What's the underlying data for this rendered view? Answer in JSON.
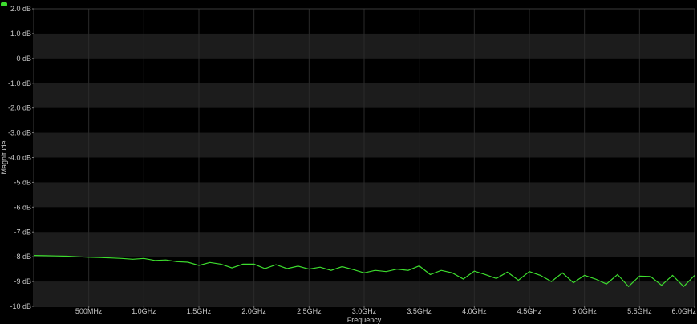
{
  "chart_data": {
    "type": "line",
    "title": "",
    "xlabel": "Frequency",
    "ylabel": "Magnitude",
    "xlim": [
      0,
      6.0
    ],
    "ylim": [
      -10,
      2
    ],
    "x_unit": "GHz",
    "y_unit": "dB",
    "x_ticks": [
      {
        "value": 0.5,
        "label": "500MHz"
      },
      {
        "value": 1.0,
        "label": "1.0GHz"
      },
      {
        "value": 1.5,
        "label": "1.5GHz"
      },
      {
        "value": 2.0,
        "label": "2.0GHz"
      },
      {
        "value": 2.5,
        "label": "2.5GHz"
      },
      {
        "value": 3.0,
        "label": "3.0GHz"
      },
      {
        "value": 3.5,
        "label": "3.5GHz"
      },
      {
        "value": 4.0,
        "label": "4.0GHz"
      },
      {
        "value": 4.5,
        "label": "4.5GHz"
      },
      {
        "value": 5.0,
        "label": "5.0GHz"
      },
      {
        "value": 5.5,
        "label": "5.5GHz"
      },
      {
        "value": 6.0,
        "label": "6.0GHz"
      }
    ],
    "y_ticks": [
      {
        "value": 2,
        "label": "2.0 dB"
      },
      {
        "value": 1,
        "label": "1.0 dB"
      },
      {
        "value": 0,
        "label": "0 dB"
      },
      {
        "value": -1,
        "label": "-1.0 dB"
      },
      {
        "value": -2,
        "label": "-2.0 dB"
      },
      {
        "value": -3,
        "label": "-3.0 dB"
      },
      {
        "value": -4,
        "label": "-4.0 dB"
      },
      {
        "value": -5,
        "label": "-5 dB"
      },
      {
        "value": -6,
        "label": "-6 dB"
      },
      {
        "value": -7,
        "label": "-7 dB"
      },
      {
        "value": -8,
        "label": "-8 dB"
      },
      {
        "value": -9,
        "label": "-9 dB"
      },
      {
        "value": -10,
        "label": "-10 dB"
      }
    ],
    "grid": true,
    "colors": {
      "background": "#000000",
      "band": "#1c1c1c",
      "grid": "#2a2a2a",
      "series": "#3ddc2e"
    },
    "series": [
      {
        "x": [
          0.0,
          0.1,
          0.2,
          0.3,
          0.4,
          0.5,
          0.6,
          0.7,
          0.8,
          0.9,
          1.0,
          1.1,
          1.2,
          1.3,
          1.4,
          1.5,
          1.6,
          1.7,
          1.8,
          1.9,
          2.0,
          2.1,
          2.2,
          2.3,
          2.4,
          2.5,
          2.6,
          2.7,
          2.8,
          2.9,
          3.0,
          3.1,
          3.2,
          3.3,
          3.4,
          3.5,
          3.6,
          3.7,
          3.8,
          3.9,
          4.0,
          4.1,
          4.2,
          4.3,
          4.4,
          4.5,
          4.6,
          4.7,
          4.8,
          4.9,
          5.0,
          5.1,
          5.2,
          5.3,
          5.4,
          5.5,
          5.6,
          5.7,
          5.8,
          5.9,
          6.0
        ],
        "y": [
          -7.95,
          -7.96,
          -7.97,
          -7.98,
          -8.0,
          -8.02,
          -8.03,
          -8.05,
          -8.07,
          -8.1,
          -8.07,
          -8.15,
          -8.13,
          -8.2,
          -8.22,
          -8.35,
          -8.23,
          -8.3,
          -8.45,
          -8.3,
          -8.3,
          -8.48,
          -8.32,
          -8.48,
          -8.38,
          -8.5,
          -8.42,
          -8.55,
          -8.4,
          -8.52,
          -8.65,
          -8.55,
          -8.6,
          -8.5,
          -8.55,
          -8.37,
          -8.72,
          -8.55,
          -8.65,
          -8.9,
          -8.58,
          -8.72,
          -8.88,
          -8.62,
          -8.95,
          -8.6,
          -8.75,
          -9.0,
          -8.65,
          -9.05,
          -8.75,
          -8.9,
          -9.1,
          -8.72,
          -9.2,
          -8.78,
          -8.8,
          -9.15,
          -8.75,
          -9.2,
          -8.75
        ]
      }
    ]
  }
}
